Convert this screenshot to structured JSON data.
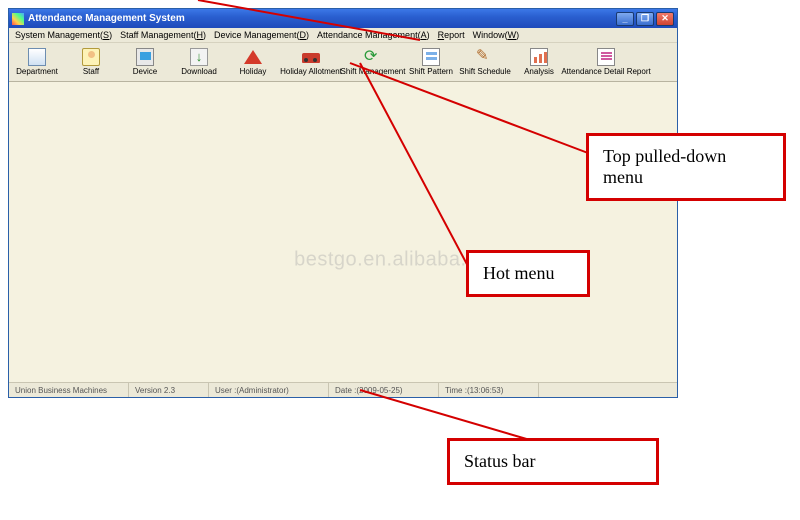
{
  "window": {
    "title": "Attendance Management System"
  },
  "menubar": {
    "items": [
      {
        "label": "System Management",
        "key": "S"
      },
      {
        "label": "Staff Management",
        "key": "H"
      },
      {
        "label": "Device Management",
        "key": "D"
      },
      {
        "label": "Attendance Management",
        "key": "A"
      },
      {
        "label": "Report",
        "key": "R"
      },
      {
        "label": "Window",
        "key": "W"
      }
    ]
  },
  "toolbar": {
    "buttons": [
      {
        "label": "Department",
        "icon": "dept-icon"
      },
      {
        "label": "Staff",
        "icon": "staff-icon"
      },
      {
        "label": "Device",
        "icon": "device-icon"
      },
      {
        "label": "Download",
        "icon": "download-icon"
      },
      {
        "label": "Holiday",
        "icon": "holiday-icon"
      },
      {
        "label": "Holiday Allotment",
        "icon": "holiday-alloc-icon"
      },
      {
        "label": "Shift Management",
        "icon": "shift-mgmt-icon"
      },
      {
        "label": "Shift Pattern",
        "icon": "shift-pattern-icon"
      },
      {
        "label": "Shift Schedule",
        "icon": "shift-schedule-icon"
      },
      {
        "label": "Analysis",
        "icon": "analysis-icon"
      },
      {
        "label": "Attendance Detail Report",
        "icon": "attendance-report-icon"
      }
    ]
  },
  "statusbar": {
    "company": "Union Business Machines",
    "version": "Version 2.3",
    "user_label": "User :",
    "user_value": "(Administrator)",
    "date_label": "Date :",
    "date_value": "(2009-05-25)",
    "time_label": "Time :",
    "time_value": "(13:06:53)"
  },
  "callouts": {
    "top_menu": "Top pulled-down menu",
    "hot_menu": "Hot menu",
    "status_bar": "Status bar"
  },
  "watermark": "bestgo.en.alibaba.com"
}
